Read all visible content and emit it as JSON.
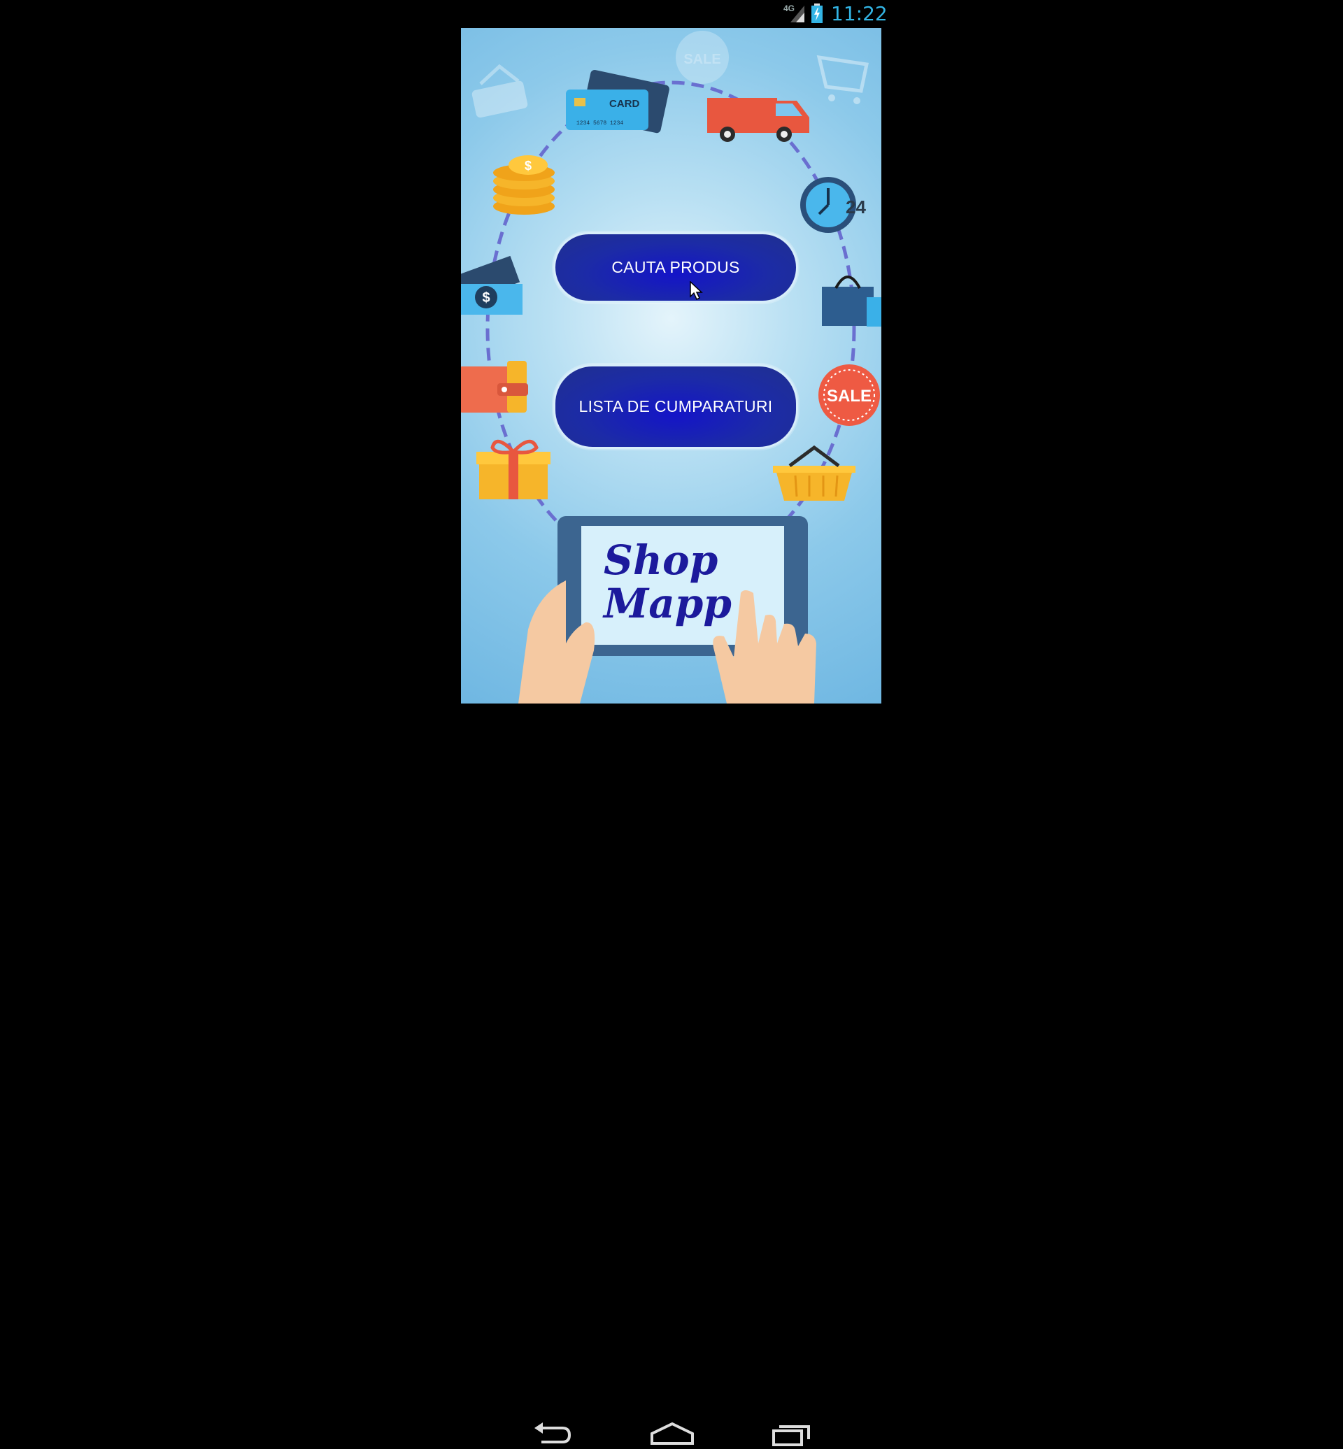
{
  "status_bar": {
    "network": "4G",
    "time": "11:22"
  },
  "main": {
    "search_button_label": "CAUTA PRODUS",
    "shopping_list_button_label": "LISTA DE CUMPARATURI"
  },
  "logo": {
    "line1": "Shop",
    "line2": "Mapp"
  },
  "decorations": {
    "card_label": "CARD",
    "card_number": "1234 5678 1234",
    "sale_tag_top": "SALE",
    "sale_tag_right": "SALE",
    "clock_badge": "24",
    "coin_symbol": "$",
    "bill_symbol": "$"
  },
  "nav": {
    "icons": [
      "back-icon",
      "home-icon",
      "recent-apps-icon"
    ]
  },
  "colors": {
    "button_fill": "#1c2ba6",
    "clock_text": "#33b5e5",
    "logo_text": "#1c1a9c",
    "dotted_ring": "#6a6fd0"
  }
}
